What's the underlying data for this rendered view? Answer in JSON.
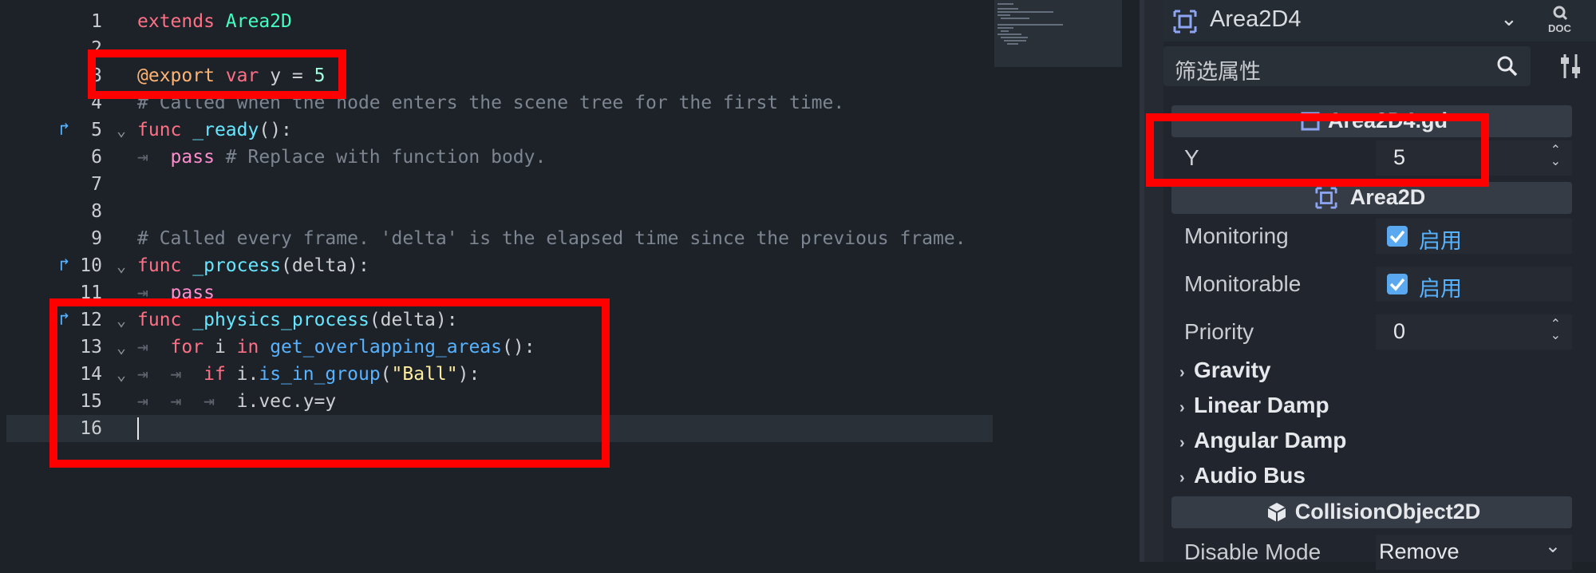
{
  "editor": {
    "lines": [
      {
        "n": "1",
        "tokens": [
          [
            "kw",
            "extends"
          ],
          [
            "",
            " "
          ],
          [
            "id",
            "Area2D"
          ]
        ]
      },
      {
        "n": "2",
        "tokens": []
      },
      {
        "n": "3",
        "tokens": [
          [
            "an",
            "@export"
          ],
          [
            "",
            " "
          ],
          [
            "kw",
            "var"
          ],
          [
            "",
            " y = "
          ],
          [
            "num",
            "5"
          ]
        ]
      },
      {
        "n": "4",
        "tokens": [
          [
            "cm",
            "# Called when the node enters the scene tree for the first time."
          ]
        ]
      },
      {
        "n": "5",
        "tokens": [
          [
            "kw",
            "func"
          ],
          [
            "",
            " "
          ],
          [
            "fn2",
            "_ready"
          ],
          [
            "",
            "():"
          ]
        ],
        "override": true,
        "fold": true
      },
      {
        "n": "6",
        "tokens": [
          [
            "tab",
            "⇥  "
          ],
          [
            "kw2",
            "pass"
          ],
          [
            "cm",
            " # Replace with function body."
          ]
        ]
      },
      {
        "n": "7",
        "tokens": []
      },
      {
        "n": "8",
        "tokens": []
      },
      {
        "n": "9",
        "tokens": [
          [
            "cm",
            "# Called every frame. 'delta' is the elapsed time since the previous frame."
          ]
        ]
      },
      {
        "n": "10",
        "tokens": [
          [
            "kw",
            "func"
          ],
          [
            "",
            " "
          ],
          [
            "fn2",
            "_process"
          ],
          [
            "",
            "(delta):"
          ]
        ],
        "override": true,
        "fold": true
      },
      {
        "n": "11",
        "tokens": [
          [
            "tab",
            "⇥  "
          ],
          [
            "kw2",
            "pass"
          ]
        ]
      },
      {
        "n": "12",
        "tokens": [
          [
            "kw",
            "func"
          ],
          [
            "",
            " "
          ],
          [
            "fn2",
            "_physics_process"
          ],
          [
            "",
            "(delta):"
          ]
        ],
        "override": true,
        "fold": true
      },
      {
        "n": "13",
        "tokens": [
          [
            "tab",
            "⇥  "
          ],
          [
            "kw",
            "for"
          ],
          [
            "",
            " i "
          ],
          [
            "kw",
            "in"
          ],
          [
            "",
            " "
          ],
          [
            "fn",
            "get_overlapping_areas"
          ],
          [
            "",
            "():"
          ]
        ],
        "fold": true
      },
      {
        "n": "14",
        "tokens": [
          [
            "tab",
            "⇥  ⇥  "
          ],
          [
            "kw",
            "if"
          ],
          [
            "",
            " i."
          ],
          [
            "fn",
            "is_in_group"
          ],
          [
            "",
            "("
          ],
          [
            "str",
            "\"Ball\""
          ],
          [
            "",
            "):"
          ]
        ],
        "fold": true
      },
      {
        "n": "15",
        "tokens": [
          [
            "tab",
            "⇥  ⇥  ⇥  "
          ],
          [
            "",
            "i.vec.y=y"
          ]
        ]
      },
      {
        "n": "16",
        "tokens": []
      }
    ]
  },
  "inspector": {
    "node_name": "Area2D4",
    "filter_placeholder": "筛选属性",
    "script_section": "Area2D4.gd",
    "y_label": "Y",
    "y_value": "5",
    "area_section": "Area2D",
    "monitoring_label": "Monitoring",
    "monitoring_value": "启用",
    "monitorable_label": "Monitorable",
    "monitorable_value": "启用",
    "priority_label": "Priority",
    "priority_value": "0",
    "groups": [
      "Gravity",
      "Linear Damp",
      "Angular Damp",
      "Audio Bus"
    ],
    "collision_section": "CollisionObject2D",
    "disable_mode_label": "Disable Mode",
    "disable_mode_value": "Remove",
    "doc_label": "DOC"
  },
  "colors": {
    "highlight": "#ff0000",
    "accent": "#57b3ff"
  }
}
